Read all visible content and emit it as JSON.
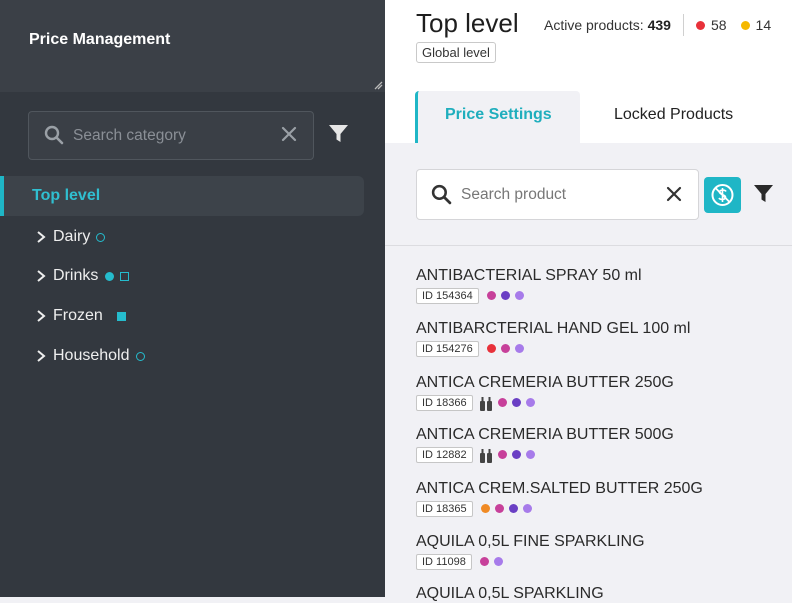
{
  "sidebar": {
    "title": "Price Management",
    "search_placeholder": "Search category",
    "items": [
      {
        "label": "Top level",
        "selected": true
      },
      {
        "label": "Dairy",
        "chev": "chevron-right-icon",
        "markers": [
          "ring"
        ]
      },
      {
        "label": "Drinks",
        "chev": "chevron-right-icon",
        "markers": [
          "dot",
          "square-outline"
        ]
      },
      {
        "label": "Frozen",
        "chev": "chevron-right-icon",
        "markers": [
          "square-filled"
        ]
      },
      {
        "label": "Household",
        "chev": "chevron-right-icon",
        "markers": [
          "ring"
        ]
      }
    ]
  },
  "header": {
    "title": "Top level",
    "badge": "Global level",
    "active_label": "Active products:",
    "active_count": "439",
    "red_count": "58",
    "yellow_count": "14"
  },
  "tabs": [
    {
      "label": "Price Settings",
      "active": true
    },
    {
      "label": "Locked Products",
      "active": false
    }
  ],
  "search": {
    "placeholder": "Search product"
  },
  "colors": {
    "accent": "#1fb6c6",
    "red": "#e8313a",
    "yellow": "#f5b800",
    "magenta": "#c7409a",
    "purple": "#6a3fc4",
    "lavender": "#a77bea",
    "orange": "#f08a24"
  },
  "products": [
    {
      "name": "ANTIBACTERIAL SPRAY 50 ml",
      "id": "ID 154364",
      "bottles": false,
      "dots": [
        "magenta",
        "purple",
        "lavender"
      ]
    },
    {
      "name": "ANTIBARCTERIAL HAND GEL 100 ml",
      "id": "ID 154276",
      "bottles": false,
      "dots": [
        "red",
        "magenta",
        "lavender"
      ]
    },
    {
      "name": "ANTICA CREMERIA BUTTER 250G",
      "id": "ID 18366",
      "bottles": true,
      "dots": [
        "magenta",
        "purple",
        "lavender"
      ]
    },
    {
      "name": "ANTICA CREMERIA BUTTER 500G",
      "id": "ID 12882",
      "bottles": true,
      "dots": [
        "magenta",
        "purple",
        "lavender"
      ]
    },
    {
      "name": "ANTICA CREM.SALTED BUTTER 250G",
      "id": "ID 18365",
      "bottles": false,
      "dots": [
        "orange",
        "magenta",
        "purple",
        "lavender"
      ]
    },
    {
      "name": "AQUILA 0,5L FINE SPARKLING",
      "id": "ID 11098",
      "bottles": false,
      "dots": [
        "magenta",
        "lavender"
      ]
    },
    {
      "name": "AQUILA 0,5L SPARKLING",
      "id": "",
      "bottles": false,
      "dots": []
    }
  ]
}
